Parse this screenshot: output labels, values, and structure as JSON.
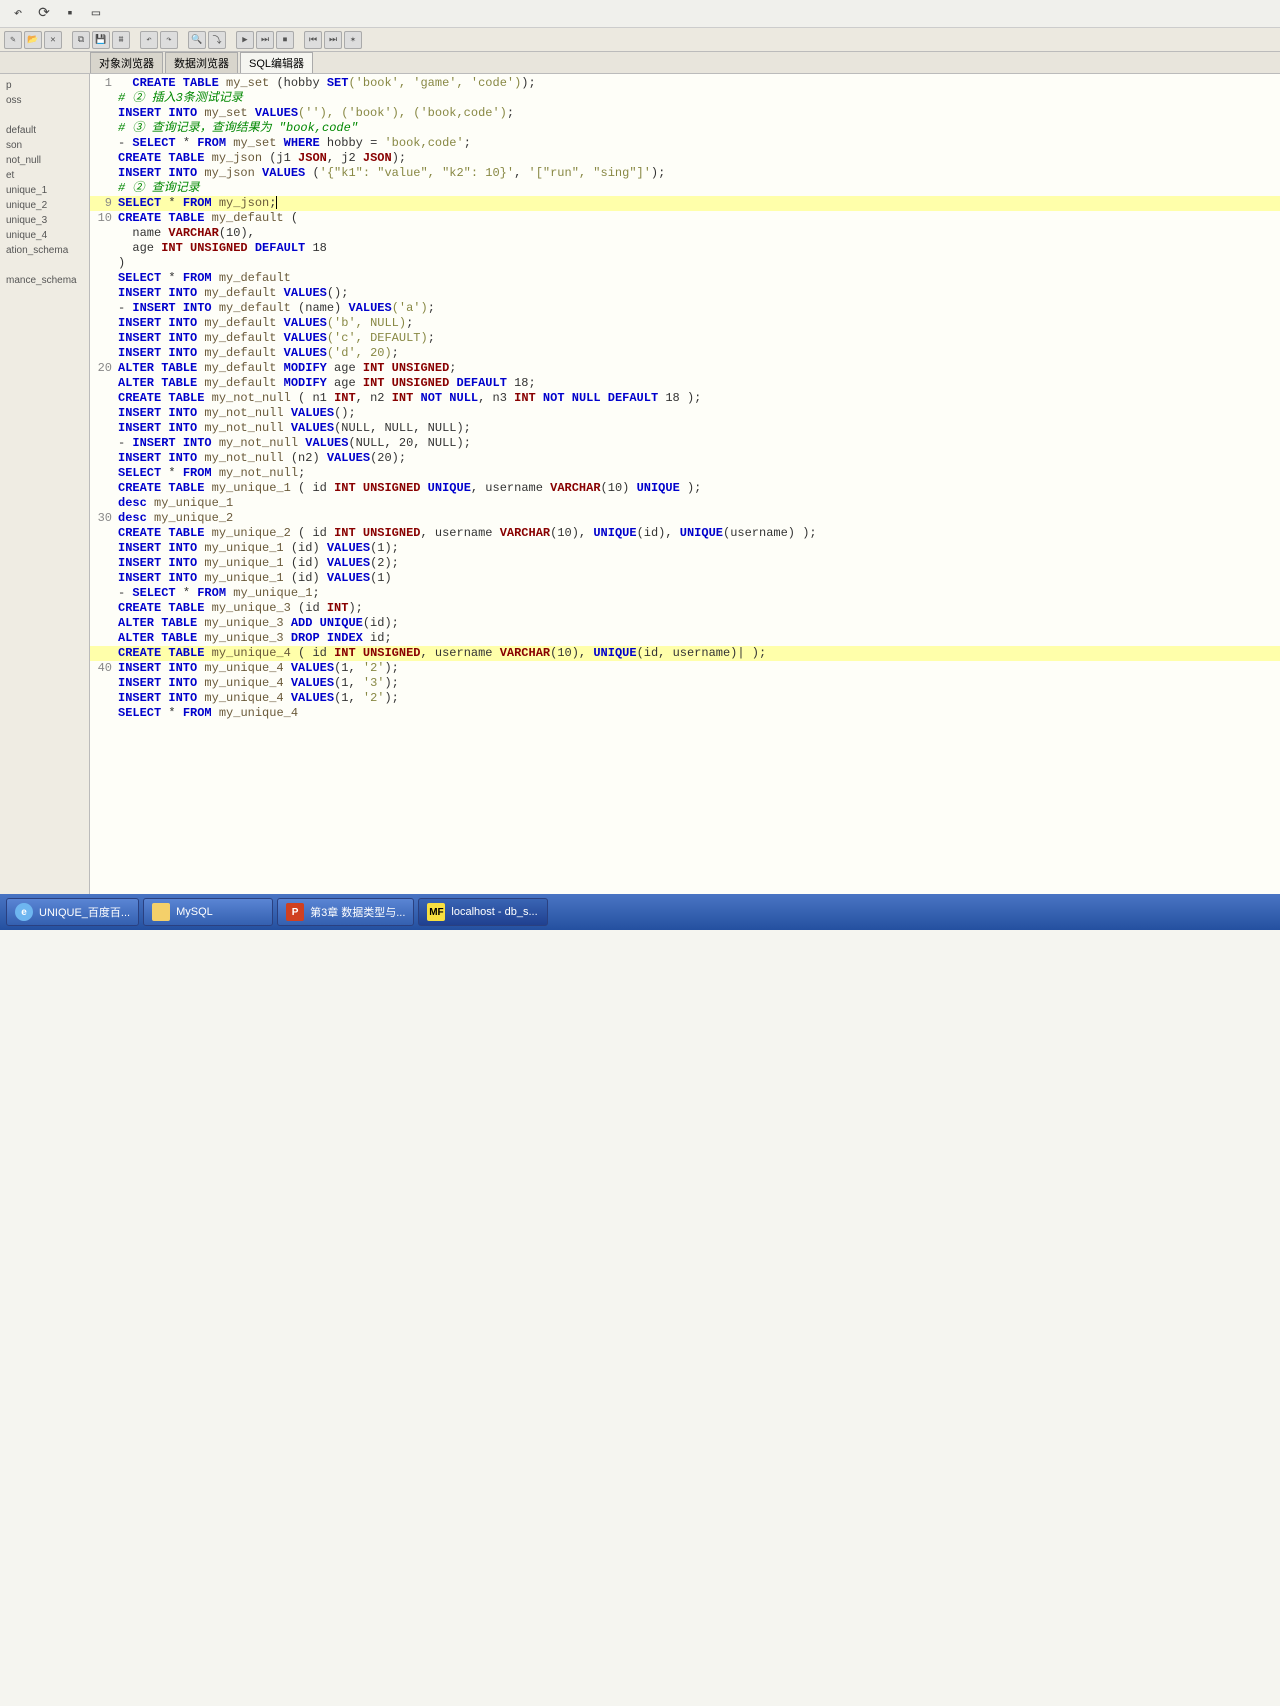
{
  "tabs": [
    {
      "label": "对象浏览器"
    },
    {
      "label": "数据浏览器"
    },
    {
      "label": "SQL编辑器"
    }
  ],
  "sidebar": {
    "items": [
      "p",
      "oss",
      "",
      "default",
      "son",
      "not_null",
      "et",
      "unique_1",
      "unique_2",
      "unique_3",
      "unique_4",
      "ation_schema",
      "",
      "mance_schema"
    ]
  },
  "code": {
    "lines": [
      {
        "n": "1",
        "hl": false,
        "tokens": [
          [
            "kw",
            "  CREATE TABLE"
          ],
          [
            "id",
            " my_set "
          ],
          [
            "nm",
            "(hobby "
          ],
          [
            "kw",
            "SET"
          ],
          [
            "st",
            "('book', 'game', 'code')"
          ],
          [
            "nm",
            ");"
          ]
        ]
      },
      {
        "n": "",
        "hl": false,
        "tokens": [
          [
            "cm",
            "# ② 插入3条测试记录"
          ]
        ]
      },
      {
        "n": "",
        "hl": false,
        "tokens": [
          [
            "kw",
            "INSERT INTO"
          ],
          [
            "id",
            " my_set "
          ],
          [
            "kw",
            "VALUES"
          ],
          [
            "st",
            "(''), ('book'), ('book,code')"
          ],
          [
            "nm",
            ";"
          ]
        ]
      },
      {
        "n": "",
        "hl": false,
        "tokens": [
          [
            "cm",
            "# ③ 查询记录，查询结果为 \"book,code\""
          ]
        ]
      },
      {
        "n": "",
        "hl": false,
        "tokens": [
          [
            "nm",
            "- "
          ],
          [
            "kw",
            "SELECT"
          ],
          [
            "nm",
            " * "
          ],
          [
            "kw",
            "FROM"
          ],
          [
            "id",
            " my_set "
          ],
          [
            "kw",
            "WHERE"
          ],
          [
            "nm",
            " hobby = "
          ],
          [
            "st",
            "'book,code'"
          ],
          [
            "nm",
            ";"
          ]
        ]
      },
      {
        "n": "",
        "hl": false,
        "tokens": [
          [
            "kw",
            "CREATE TABLE"
          ],
          [
            "id",
            " my_json "
          ],
          [
            "nm",
            "(j1 "
          ],
          [
            "ty",
            "JSON"
          ],
          [
            "nm",
            ", j2 "
          ],
          [
            "ty",
            "JSON"
          ],
          [
            "nm",
            ");"
          ]
        ]
      },
      {
        "n": "",
        "hl": false,
        "tokens": [
          [
            "kw",
            "INSERT INTO"
          ],
          [
            "id",
            " my_json "
          ],
          [
            "kw",
            "VALUES"
          ],
          [
            "nm",
            " ("
          ],
          [
            "st",
            "'{\"k1\": \"value\", \"k2\": 10}'"
          ],
          [
            "nm",
            ", "
          ],
          [
            "st",
            "'[\"run\", \"sing\"]'"
          ],
          [
            "nm",
            ");"
          ]
        ]
      },
      {
        "n": "",
        "hl": false,
        "tokens": [
          [
            "cm",
            "# ② 查询记录"
          ]
        ]
      },
      {
        "n": "9",
        "hl": true,
        "tokens": [
          [
            "kw",
            "SELECT"
          ],
          [
            "nm",
            " * "
          ],
          [
            "kw",
            "FROM"
          ],
          [
            "id",
            " my_json"
          ],
          [
            "nm",
            ";"
          ]
        ],
        "cursor": true
      },
      {
        "n": "10",
        "hl": false,
        "tokens": [
          [
            "kw",
            "CREATE TABLE"
          ],
          [
            "id",
            " my_default "
          ],
          [
            "nm",
            "("
          ]
        ]
      },
      {
        "n": "",
        "hl": false,
        "tokens": [
          [
            "nm",
            "  name "
          ],
          [
            "ty",
            "VARCHAR"
          ],
          [
            "nm",
            "(10),"
          ]
        ]
      },
      {
        "n": "",
        "hl": false,
        "tokens": [
          [
            "nm",
            "  age "
          ],
          [
            "ty",
            "INT UNSIGNED"
          ],
          [
            "kw",
            " DEFAULT"
          ],
          [
            "nm",
            " 18"
          ]
        ]
      },
      {
        "n": "",
        "hl": false,
        "tokens": [
          [
            "nm",
            ")"
          ]
        ]
      },
      {
        "n": "",
        "hl": false,
        "tokens": [
          [
            "kw",
            "SELECT"
          ],
          [
            "nm",
            " * "
          ],
          [
            "kw",
            "FROM"
          ],
          [
            "id",
            " my_default"
          ]
        ]
      },
      {
        "n": "",
        "hl": false,
        "tokens": [
          [
            "kw",
            "INSERT INTO"
          ],
          [
            "id",
            " my_default "
          ],
          [
            "kw",
            "VALUES"
          ],
          [
            "nm",
            "();"
          ]
        ]
      },
      {
        "n": "",
        "hl": false,
        "tokens": [
          [
            "nm",
            "- "
          ],
          [
            "kw",
            "INSERT INTO"
          ],
          [
            "id",
            " my_default "
          ],
          [
            "nm",
            "(name) "
          ],
          [
            "kw",
            "VALUES"
          ],
          [
            "st",
            "('a')"
          ],
          [
            "nm",
            ";"
          ]
        ]
      },
      {
        "n": "",
        "hl": false,
        "tokens": [
          [
            "kw",
            "INSERT INTO"
          ],
          [
            "id",
            " my_default "
          ],
          [
            "kw",
            "VALUES"
          ],
          [
            "st",
            "('b', NULL)"
          ],
          [
            "nm",
            ";"
          ]
        ]
      },
      {
        "n": "",
        "hl": false,
        "tokens": [
          [
            "kw",
            "INSERT INTO"
          ],
          [
            "id",
            " my_default "
          ],
          [
            "kw",
            "VALUES"
          ],
          [
            "st",
            "('c', DEFAULT)"
          ],
          [
            "nm",
            ";"
          ]
        ]
      },
      {
        "n": "",
        "hl": false,
        "tokens": [
          [
            "kw",
            "INSERT INTO"
          ],
          [
            "id",
            " my_default "
          ],
          [
            "kw",
            "VALUES"
          ],
          [
            "st",
            "('d', 20)"
          ],
          [
            "nm",
            ";"
          ]
        ]
      },
      {
        "n": "20",
        "hl": false,
        "tokens": [
          [
            "kw",
            "ALTER TABLE"
          ],
          [
            "id",
            " my_default "
          ],
          [
            "kw",
            "MODIFY"
          ],
          [
            "nm",
            " age "
          ],
          [
            "ty",
            "INT UNSIGNED"
          ],
          [
            "nm",
            ";"
          ]
        ]
      },
      {
        "n": "",
        "hl": false,
        "tokens": [
          [
            "kw",
            "ALTER TABLE"
          ],
          [
            "id",
            " my_default "
          ],
          [
            "kw",
            "MODIFY"
          ],
          [
            "nm",
            " age "
          ],
          [
            "ty",
            "INT UNSIGNED"
          ],
          [
            "kw",
            " DEFAULT"
          ],
          [
            "nm",
            " 18;"
          ]
        ]
      },
      {
        "n": "",
        "hl": false,
        "tokens": [
          [
            "kw",
            "CREATE TABLE"
          ],
          [
            "id",
            " my_not_null "
          ],
          [
            "nm",
            "( n1 "
          ],
          [
            "ty",
            "INT"
          ],
          [
            "nm",
            ", n2 "
          ],
          [
            "ty",
            "INT"
          ],
          [
            "kw",
            " NOT NULL"
          ],
          [
            "nm",
            ", n3 "
          ],
          [
            "ty",
            "INT"
          ],
          [
            "kw",
            " NOT NULL DEFAULT"
          ],
          [
            "nm",
            " 18 );"
          ]
        ]
      },
      {
        "n": "",
        "hl": false,
        "tokens": [
          [
            "kw",
            "INSERT INTO"
          ],
          [
            "id",
            " my_not_null "
          ],
          [
            "kw",
            "VALUES"
          ],
          [
            "nm",
            "();"
          ]
        ]
      },
      {
        "n": "",
        "hl": false,
        "tokens": [
          [
            "kw",
            "INSERT INTO"
          ],
          [
            "id",
            " my_not_null "
          ],
          [
            "kw",
            "VALUES"
          ],
          [
            "nm",
            "(NULL, NULL, NULL);"
          ]
        ]
      },
      {
        "n": "",
        "hl": false,
        "tokens": [
          [
            "nm",
            "- "
          ],
          [
            "kw",
            "INSERT INTO"
          ],
          [
            "id",
            " my_not_null "
          ],
          [
            "kw",
            "VALUES"
          ],
          [
            "nm",
            "(NULL, 20, NULL);"
          ]
        ]
      },
      {
        "n": "",
        "hl": false,
        "tokens": [
          [
            "kw",
            "INSERT INTO"
          ],
          [
            "id",
            " my_not_null "
          ],
          [
            "nm",
            "(n2) "
          ],
          [
            "kw",
            "VALUES"
          ],
          [
            "nm",
            "(20);"
          ]
        ]
      },
      {
        "n": "",
        "hl": false,
        "tokens": [
          [
            "kw",
            "SELECT"
          ],
          [
            "nm",
            " * "
          ],
          [
            "kw",
            "FROM"
          ],
          [
            "id",
            " my_not_null"
          ],
          [
            "nm",
            ";"
          ]
        ]
      },
      {
        "n": "",
        "hl": false,
        "tokens": [
          [
            "kw",
            "CREATE TABLE"
          ],
          [
            "id",
            " my_unique_1 "
          ],
          [
            "nm",
            "( id "
          ],
          [
            "ty",
            "INT UNSIGNED"
          ],
          [
            "kw",
            " UNIQUE"
          ],
          [
            "nm",
            ", username "
          ],
          [
            "ty",
            "VARCHAR"
          ],
          [
            "nm",
            "(10) "
          ],
          [
            "kw",
            "UNIQUE"
          ],
          [
            "nm",
            " );"
          ]
        ]
      },
      {
        "n": "",
        "hl": false,
        "tokens": [
          [
            "kw",
            "desc"
          ],
          [
            "id",
            " my_unique_1"
          ]
        ]
      },
      {
        "n": "30",
        "hl": false,
        "tokens": [
          [
            "kw",
            "desc"
          ],
          [
            "id",
            " my_unique_2"
          ]
        ]
      },
      {
        "n": "",
        "hl": false,
        "tokens": [
          [
            "kw",
            "CREATE TABLE"
          ],
          [
            "id",
            " my_unique_2 "
          ],
          [
            "nm",
            "( id "
          ],
          [
            "ty",
            "INT UNSIGNED"
          ],
          [
            "nm",
            ", username "
          ],
          [
            "ty",
            "VARCHAR"
          ],
          [
            "nm",
            "(10), "
          ],
          [
            "kw",
            "UNIQUE"
          ],
          [
            "nm",
            "(id), "
          ],
          [
            "kw",
            "UNIQUE"
          ],
          [
            "nm",
            "(username) );"
          ]
        ]
      },
      {
        "n": "",
        "hl": false,
        "tokens": [
          [
            "kw",
            "INSERT INTO"
          ],
          [
            "id",
            " my_unique_1 "
          ],
          [
            "nm",
            "(id) "
          ],
          [
            "kw",
            "VALUES"
          ],
          [
            "nm",
            "(1);"
          ]
        ]
      },
      {
        "n": "",
        "hl": false,
        "tokens": [
          [
            "kw",
            "INSERT INTO"
          ],
          [
            "id",
            " my_unique_1 "
          ],
          [
            "nm",
            "(id) "
          ],
          [
            "kw",
            "VALUES"
          ],
          [
            "nm",
            "(2);"
          ]
        ]
      },
      {
        "n": "",
        "hl": false,
        "tokens": [
          [
            "kw",
            "INSERT INTO"
          ],
          [
            "id",
            " my_unique_1 "
          ],
          [
            "nm",
            "(id) "
          ],
          [
            "kw",
            "VALUES"
          ],
          [
            "nm",
            "(1)"
          ]
        ]
      },
      {
        "n": "",
        "hl": false,
        "tokens": [
          [
            "nm",
            "- "
          ],
          [
            "kw",
            "SELECT"
          ],
          [
            "nm",
            " * "
          ],
          [
            "kw",
            "FROM"
          ],
          [
            "id",
            " my_unique_1"
          ],
          [
            "nm",
            ";"
          ]
        ]
      },
      {
        "n": "",
        "hl": false,
        "tokens": [
          [
            "kw",
            "CREATE TABLE"
          ],
          [
            "id",
            " my_unique_3 "
          ],
          [
            "nm",
            "(id "
          ],
          [
            "ty",
            "INT"
          ],
          [
            "nm",
            ");"
          ]
        ]
      },
      {
        "n": "",
        "hl": false,
        "tokens": [
          [
            "kw",
            "ALTER TABLE"
          ],
          [
            "id",
            " my_unique_3 "
          ],
          [
            "kw",
            "ADD UNIQUE"
          ],
          [
            "nm",
            "(id);"
          ]
        ]
      },
      {
        "n": "",
        "hl": false,
        "tokens": [
          [
            "kw",
            "ALTER TABLE"
          ],
          [
            "id",
            " my_unique_3 "
          ],
          [
            "kw",
            "DROP INDEX"
          ],
          [
            "nm",
            " id;"
          ]
        ]
      },
      {
        "n": "",
        "hl": true,
        "tokens": [
          [
            "kw",
            "CREATE TABLE"
          ],
          [
            "id",
            " my_unique_4 "
          ],
          [
            "nm",
            "( id "
          ],
          [
            "ty",
            "INT UNSIGNED"
          ],
          [
            "nm",
            ", username "
          ],
          [
            "ty",
            "VARCHAR"
          ],
          [
            "nm",
            "(10), "
          ],
          [
            "kw",
            "UNIQUE"
          ],
          [
            "nm",
            "(id, username)| );"
          ]
        ]
      },
      {
        "n": "40",
        "hl": false,
        "tokens": [
          [
            "kw",
            "INSERT INTO"
          ],
          [
            "id",
            " my_unique_4 "
          ],
          [
            "kw",
            "VALUES"
          ],
          [
            "nm",
            "(1, "
          ],
          [
            "st",
            "'2'"
          ],
          [
            "nm",
            ");"
          ]
        ]
      },
      {
        "n": "",
        "hl": false,
        "tokens": [
          [
            "kw",
            "INSERT INTO"
          ],
          [
            "id",
            " my_unique_4 "
          ],
          [
            "kw",
            "VALUES"
          ],
          [
            "nm",
            "(1, "
          ],
          [
            "st",
            "'3'"
          ],
          [
            "nm",
            ");"
          ]
        ]
      },
      {
        "n": "",
        "hl": false,
        "tokens": [
          [
            "kw",
            "INSERT INTO"
          ],
          [
            "id",
            " my_unique_4 "
          ],
          [
            "kw",
            "VALUES"
          ],
          [
            "nm",
            "(1, "
          ],
          [
            "st",
            "'2'"
          ],
          [
            "nm",
            ");"
          ]
        ]
      },
      {
        "n": "",
        "hl": false,
        "tokens": [
          [
            "kw",
            "SELECT"
          ],
          [
            "nm",
            " * "
          ],
          [
            "kw",
            "FROM"
          ],
          [
            "id",
            " my_unique_4"
          ]
        ]
      }
    ]
  },
  "taskbar": {
    "items": [
      {
        "icon": "ie",
        "iconText": "e",
        "label": "UNIQUE_百度百..."
      },
      {
        "icon": "folder",
        "iconText": "",
        "label": "MySQL"
      },
      {
        "icon": "ppt",
        "iconText": "P",
        "label": "第3章 数据类型与..."
      },
      {
        "icon": "mf",
        "iconText": "MF",
        "label": "localhost - db_s..."
      }
    ]
  }
}
